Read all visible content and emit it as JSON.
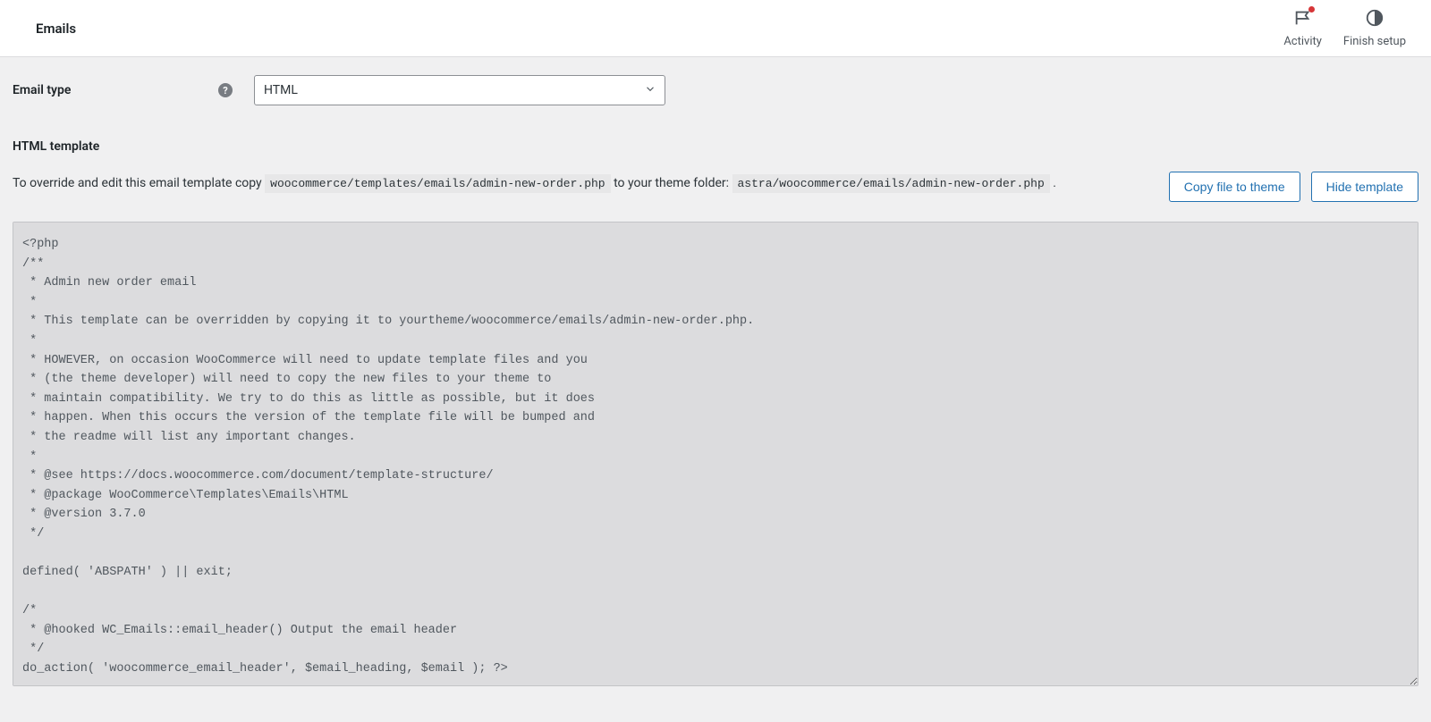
{
  "topbar": {
    "title": "Emails",
    "activity_label": "Activity",
    "finish_setup_label": "Finish setup"
  },
  "form": {
    "email_type_label": "Email type",
    "email_type_value": "HTML"
  },
  "section": {
    "html_template_title": "HTML template"
  },
  "override": {
    "prefix": "To override and edit this email template copy ",
    "src_path": "woocommerce/templates/emails/admin-new-order.php",
    "mid": " to your theme folder: ",
    "dst_path": "astra/woocommerce/emails/admin-new-order.php",
    "suffix": " ."
  },
  "buttons": {
    "copy_file": "Copy file to theme",
    "hide_template": "Hide template"
  },
  "code": {
    "content": "<?php\n/**\n * Admin new order email\n *\n * This template can be overridden by copying it to yourtheme/woocommerce/emails/admin-new-order.php.\n *\n * HOWEVER, on occasion WooCommerce will need to update template files and you\n * (the theme developer) will need to copy the new files to your theme to\n * maintain compatibility. We try to do this as little as possible, but it does\n * happen. When this occurs the version of the template file will be bumped and\n * the readme will list any important changes.\n *\n * @see https://docs.woocommerce.com/document/template-structure/\n * @package WooCommerce\\Templates\\Emails\\HTML\n * @version 3.7.0\n */\n\ndefined( 'ABSPATH' ) || exit;\n\n/*\n * @hooked WC_Emails::email_header() Output the email header\n */\ndo_action( 'woocommerce_email_header', $email_heading, $email ); ?>\n\n"
  }
}
